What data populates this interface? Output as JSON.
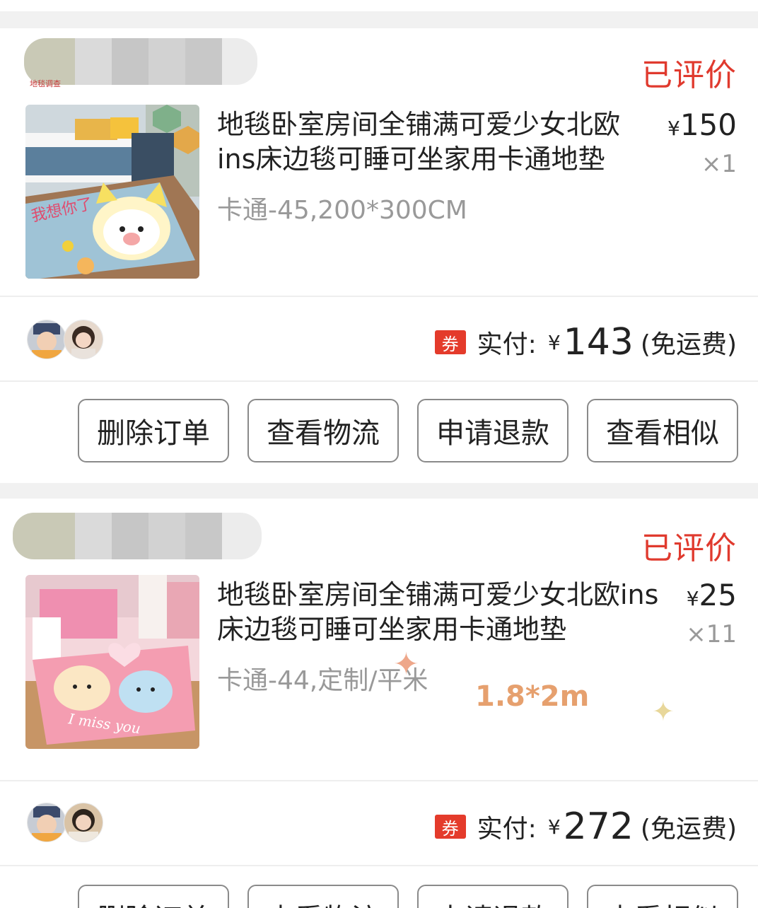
{
  "orders": [
    {
      "shop_logo_text": "地毯调查",
      "status": "已评价",
      "title": "地毯卧室房间全铺满可爱少女北欧ins床边毯可睡可坐家用卡通地垫",
      "price_symbol": "¥",
      "price": "150",
      "quantity": "×1",
      "sku": "卡通-45,200*300CM",
      "coupon_label": "券",
      "pay_label": "实付:",
      "pay_symbol": "¥",
      "pay_amount": "143",
      "shipping_note": "(免运费)",
      "buttons": [
        "删除订单",
        "查看物流",
        "申请退款",
        "查看相似"
      ]
    },
    {
      "status": "已评价",
      "title": "地毯卧室房间全铺满可爱少女北欧ins床边毯可睡可坐家用卡通地垫",
      "price_symbol": "¥",
      "price": "25",
      "quantity": "×11",
      "sku": "卡通-44,定制/平米",
      "coupon_label": "券",
      "pay_label": "实付:",
      "pay_symbol": "¥",
      "pay_amount": "272",
      "shipping_note": "(免运费)",
      "buttons": [
        "删除订单",
        "查看物流",
        "申请退款",
        "查看相似"
      ]
    }
  ],
  "annotation": {
    "text": "1.8*2m",
    "sparkle_1": "✦",
    "sparkle_2": "✦"
  },
  "colors": {
    "status_red": "#e03a2e",
    "coupon_red": "#e43b2b",
    "annotation_orange": "#e6a06e"
  }
}
